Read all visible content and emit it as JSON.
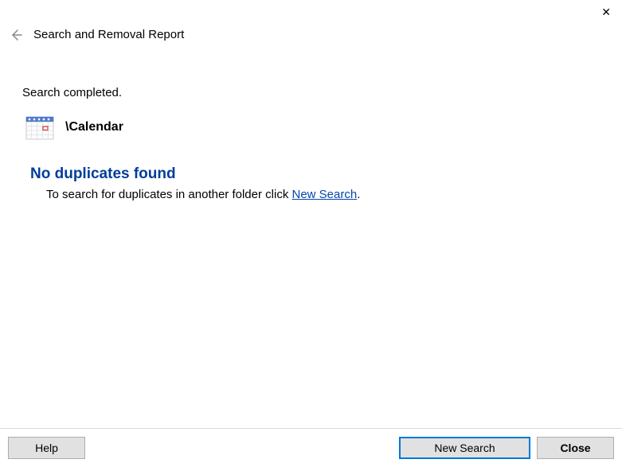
{
  "header": {
    "title": "Search and Removal Report"
  },
  "status": "Search completed.",
  "folder": {
    "path": "\\Calendar"
  },
  "result": {
    "heading": "No duplicates found",
    "sub_prefix": "To search for duplicates in another folder click ",
    "link": "New Search",
    "sub_suffix": "."
  },
  "footer": {
    "help": "Help",
    "new_search": "New Search",
    "close": "Close"
  }
}
